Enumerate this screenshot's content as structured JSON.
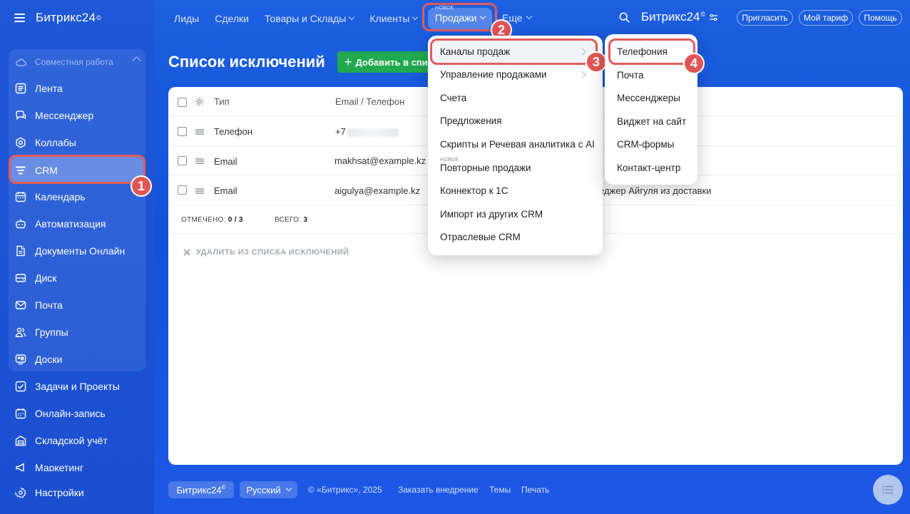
{
  "brand": {
    "name": "Битрикс24",
    "mark": "©"
  },
  "sidebar": {
    "group_label": "Совместная работа",
    "items": [
      {
        "label": "Лента",
        "icon": "feed-icon"
      },
      {
        "label": "Мессенджер",
        "icon": "chat-icon"
      },
      {
        "label": "Коллабы",
        "icon": "collab-icon"
      },
      {
        "label": "CRM",
        "icon": "crm-icon"
      },
      {
        "label": "Календарь",
        "icon": "calendar-icon"
      },
      {
        "label": "Автоматизация",
        "icon": "robot-icon"
      },
      {
        "label": "Документы Онлайн",
        "icon": "document-icon"
      },
      {
        "label": "Диск",
        "icon": "disk-icon"
      },
      {
        "label": "Почта",
        "icon": "mail-icon"
      },
      {
        "label": "Группы",
        "icon": "groups-icon"
      },
      {
        "label": "Доски",
        "icon": "board-icon"
      },
      {
        "label": "Задачи и Проекты",
        "icon": "tasks-icon"
      },
      {
        "label": "Онлайн-запись",
        "icon": "booking-icon"
      },
      {
        "label": "Складской учёт",
        "icon": "warehouse-icon"
      },
      {
        "label": "Маркетинг",
        "icon": "marketing-icon"
      },
      {
        "label": "Настройки",
        "icon": "settings-icon"
      }
    ]
  },
  "topnav": {
    "items": [
      "Лиды",
      "Сделки",
      "Товары и Склады",
      "Клиенты"
    ],
    "sales_new": "НОВОЕ",
    "sales": "Продажи",
    "more": "Еще",
    "brand": "Битрикс24",
    "invite": "Пригласить",
    "plan": "Мой тариф",
    "help": "Помощь"
  },
  "page": {
    "title": "Список исключений",
    "add_button": "Добавить в список"
  },
  "table": {
    "headers": {
      "type": "Тип",
      "contact": "Email / Телефон"
    },
    "rows": [
      {
        "type": "Телефон",
        "contact": "+7",
        "comment": ""
      },
      {
        "type": "Email",
        "contact": "makhsat@example.kz",
        "comment": ""
      },
      {
        "type": "Email",
        "contact": "aigulya@example.kz",
        "comment": "еджер Айгуля из доставки"
      }
    ],
    "selected_label": "ОТМЕЧЕНО:",
    "selected_value": "0 / 3",
    "total_label": "ВСЕГО:",
    "total_value": "3",
    "remove_action": "УДАЛИТЬ ИЗ СПИСКА ИСКЛЮЧЕНИЙ"
  },
  "sales_menu": {
    "items": [
      {
        "label": "Каналы продаж"
      },
      {
        "label": "Управление продажами"
      },
      {
        "label": "Счета"
      },
      {
        "label": "Предложения"
      },
      {
        "label": "Скрипты и Речевая аналитика с AI"
      },
      {
        "label": "Повторные продажи",
        "badge": "НОВОЕ"
      },
      {
        "label": "Коннектор к 1С"
      },
      {
        "label": "Импорт из других CRM"
      },
      {
        "label": "Отраслевые CRM"
      }
    ]
  },
  "channels_menu": {
    "items": [
      "Телефония",
      "Почта",
      "Мессенджеры",
      "Виджет на сайт",
      "CRM-формы",
      "Контакт-центр"
    ]
  },
  "callouts": [
    "1",
    "2",
    "3",
    "4"
  ],
  "footer": {
    "brand": "Битрикс24",
    "language": "Русский",
    "copyright": "© «Битрикс», 2025",
    "order": "Заказать внедрение",
    "themes": "Темы",
    "print": "Печать"
  },
  "colors": {
    "highlight": "#e25b5b",
    "badge": "#e35555",
    "add_button": "#21a94f"
  }
}
